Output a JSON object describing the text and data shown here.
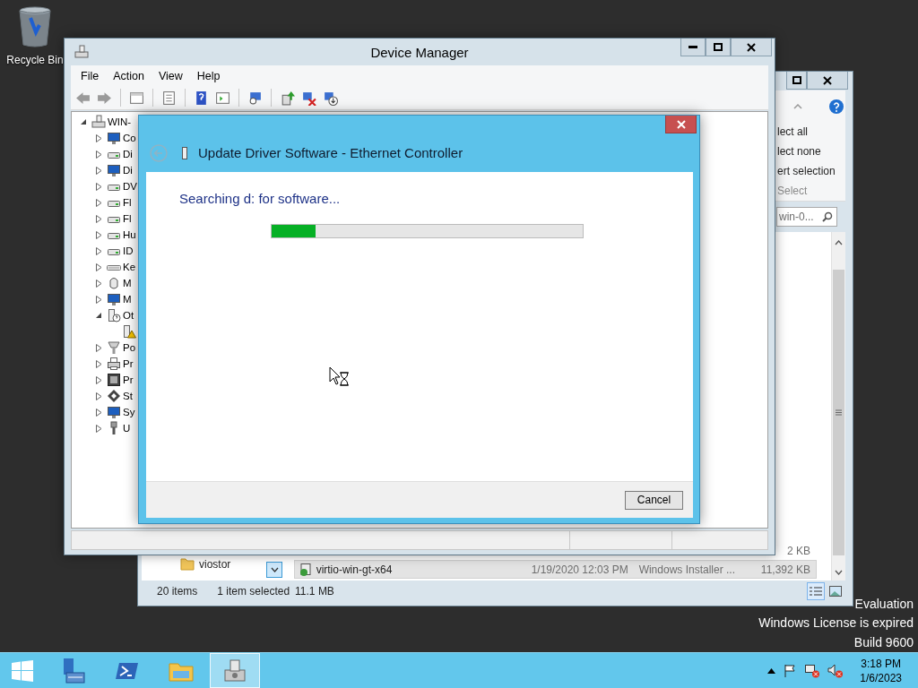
{
  "desktop": {
    "icons": [
      {
        "label": "Recycle Bin"
      }
    ],
    "license_notice": [
      "Evaluation",
      "Windows License is expired",
      "Build 9600"
    ]
  },
  "explorer": {
    "ribbon_items": [
      "lect all",
      "lect none",
      "ert selection"
    ],
    "ribbon_group": "Select",
    "search": {
      "placeholder": "win-0..."
    },
    "nav_items": [
      {
        "label": "viostor"
      }
    ],
    "files": [
      {
        "size": "2 KB",
        "selected": false
      },
      {
        "name": "virtio-win-gt-x64",
        "date": "1/19/2020 12:03 PM",
        "type": "Windows Installer ...",
        "size": "11,392 KB",
        "selected": true
      }
    ],
    "status": {
      "count": "20 items",
      "selection": "1 item selected",
      "size": "11.1 MB"
    }
  },
  "device_manager": {
    "title": "Device Manager",
    "menu": [
      "File",
      "Action",
      "View",
      "Help"
    ],
    "tree": {
      "label": "WIN-",
      "kind": "host",
      "expanded": true,
      "children": [
        {
          "label": "Co",
          "kind": "computer",
          "expanded": false
        },
        {
          "label": "Di",
          "kind": "disk",
          "expanded": false
        },
        {
          "label": "Di",
          "kind": "display",
          "expanded": false
        },
        {
          "label": "DV",
          "kind": "dvd",
          "expanded": false
        },
        {
          "label": "Fl",
          "kind": "floppy",
          "expanded": false
        },
        {
          "label": "Fl",
          "kind": "floppy",
          "expanded": false
        },
        {
          "label": "Hu",
          "kind": "hid",
          "expanded": false
        },
        {
          "label": "ID",
          "kind": "ide",
          "expanded": false
        },
        {
          "label": "Ke",
          "kind": "keyboard",
          "expanded": false
        },
        {
          "label": "M",
          "kind": "mouse",
          "expanded": false
        },
        {
          "label": "M",
          "kind": "monitor",
          "expanded": false
        },
        {
          "label": "Ot",
          "kind": "other",
          "expanded": true,
          "children": [
            {
              "kind": "warning"
            }
          ]
        },
        {
          "label": "Po",
          "kind": "port",
          "expanded": false
        },
        {
          "label": "Pr",
          "kind": "printer",
          "expanded": false
        },
        {
          "label": "Pr",
          "kind": "processor",
          "expanded": false
        },
        {
          "label": "St",
          "kind": "storage",
          "expanded": false
        },
        {
          "label": "Sy",
          "kind": "system",
          "expanded": false
        },
        {
          "label": "U",
          "kind": "usb",
          "expanded": false
        }
      ]
    }
  },
  "dialog": {
    "title": "Update Driver Software - Ethernet Controller",
    "message": "Searching d: for software...",
    "progress": {
      "level": 0.14
    },
    "buttons": [
      "Cancel"
    ]
  },
  "taskbar": {
    "apps": [
      {
        "kind": "server-manager",
        "selected": false
      },
      {
        "kind": "powershell",
        "selected": false
      },
      {
        "kind": "file-explorer",
        "selected": false
      },
      {
        "kind": "device-manager",
        "selected": true
      }
    ],
    "clock": {
      "time": "3:18 PM",
      "date": "1/6/2023"
    }
  }
}
